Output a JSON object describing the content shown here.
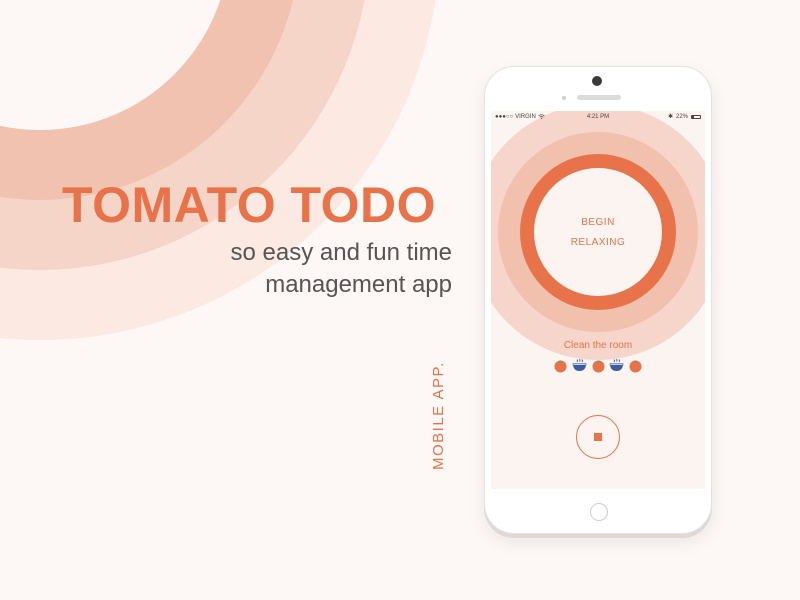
{
  "colors": {
    "accent": "#e8734a",
    "ring_light": "#f6d6ca",
    "ring_mid": "#f2c1ae",
    "bowl": "#3f5d9e",
    "background": "#fdf8f6"
  },
  "hero": {
    "title": "TOMATO TODO",
    "tagline_line1": "so easy and fun time",
    "tagline_line2": "management app",
    "vertical_label": "MOBILE APP."
  },
  "phone": {
    "status": {
      "carrier": "VIRGIN",
      "time": "4:21 PM",
      "battery": "22%",
      "battery_level": 0.22
    },
    "timer": {
      "line1": "BEGIN",
      "line2": "RELAXING"
    },
    "task": {
      "title": "Clean the room"
    },
    "sessions": [
      {
        "icon": "tomato-icon"
      },
      {
        "icon": "bowl-icon"
      },
      {
        "icon": "tomato-icon"
      },
      {
        "icon": "bowl-icon"
      },
      {
        "icon": "tomato-icon"
      }
    ],
    "controls": {
      "stop_icon": "stop-icon"
    }
  }
}
